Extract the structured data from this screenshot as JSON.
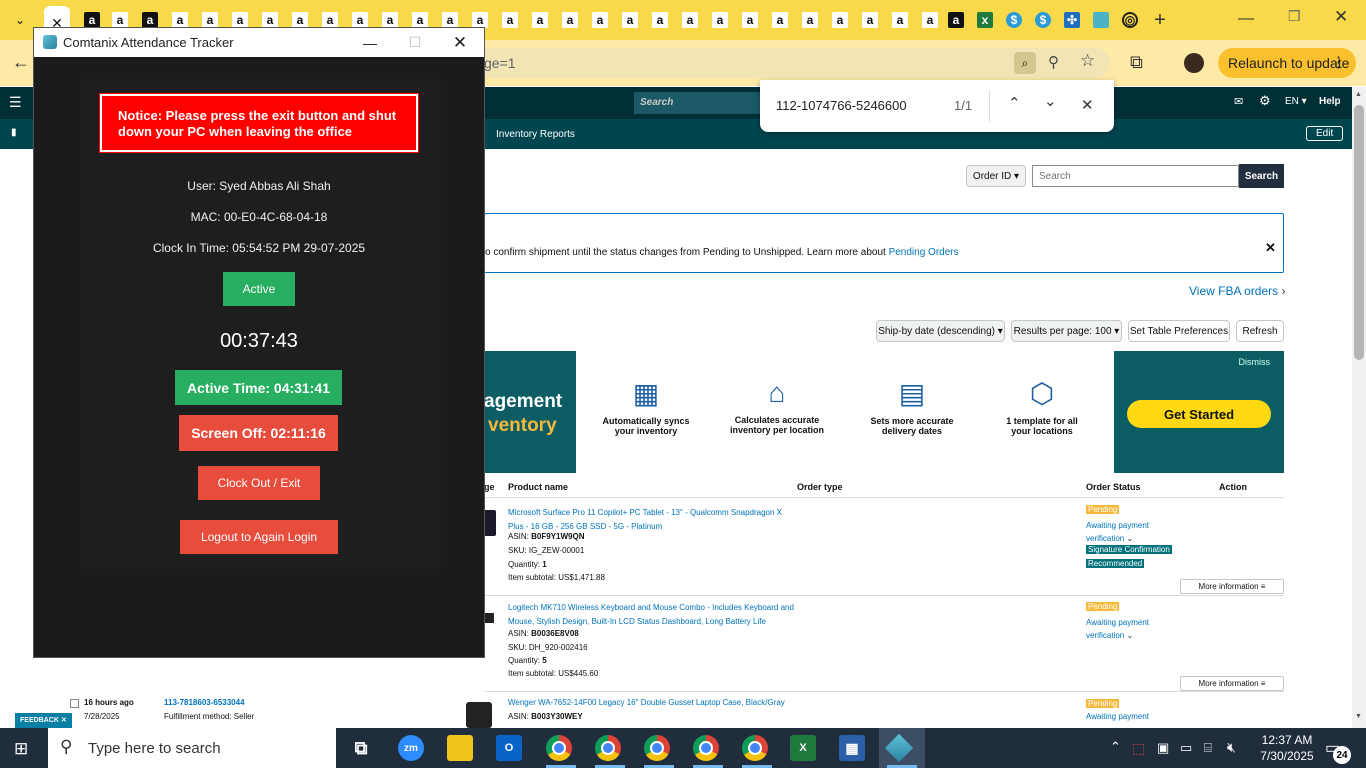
{
  "browser": {
    "relaunch_label": "Relaunch to update",
    "url_fragment": "ge=1"
  },
  "find_bar": {
    "query": "112-1074766-5246600",
    "count": "1/1"
  },
  "amazon": {
    "search_placeholder": "Search",
    "lang": "EN",
    "help": "Help",
    "inventory_reports": "Inventory Reports",
    "edit": "Edit",
    "order_id_select": "Order ID",
    "search_field_placeholder": "Search",
    "search_button": "Search",
    "banner_text": "o confirm shipment until the status changes from Pending to Unshipped. Learn more about ",
    "banner_link": "Pending Orders",
    "view_fba": "View FBA orders",
    "sort_select": "Ship-by date (descending)",
    "results_select": "Results per page: 100",
    "set_table_prefs": "Set Table Preferences",
    "refresh": "Refresh",
    "promo": {
      "title_line1": "agement",
      "title_line2": "ventory",
      "features": [
        {
          "icon": "barcode-scanner-icon",
          "label": "Automatically syncs your inventory"
        },
        {
          "icon": "warehouse-icon",
          "label": "Calculates accurate inventory per location"
        },
        {
          "icon": "calendar-check-icon",
          "label": "Sets more accurate delivery dates"
        },
        {
          "icon": "box-hand-icon",
          "label": "1 template for all your locations"
        }
      ],
      "dismiss": "Dismiss",
      "get_started": "Get Started"
    },
    "table_headers": {
      "age": "ge",
      "product": "Product name",
      "order_type": "Order type",
      "status": "Order Status",
      "action": "Action"
    },
    "orders": [
      {
        "product": "Microsoft Surface Pro 11 Copilot+ PC Tablet - 13\" - Qualcomm Snapdragon X Plus - 16 GB - 256 GB SSD - 5G - Platinum",
        "asin_label": "ASIN: ",
        "asin": "B0F9Y1W9QN",
        "sku": "SKU: IG_ZEW-00001",
        "qty_label": "Quantity: ",
        "qty": "1",
        "subtotal": "Item subtotal: US$1,471.88",
        "status_badge": "Pending",
        "status_text": "Awaiting payment verification",
        "sig1": "Signature Confirmation",
        "sig2": "Recommended",
        "more": "More information"
      },
      {
        "product": "Logitech MK710 Wireless Keyboard and Mouse Combo - Includes Keyboard and Mouse, Stylish Design, Built-In LCD Status Dashboard, Long Battery Life",
        "asin_label": "ASIN: ",
        "asin": "B0036E8V08",
        "sku": "SKU: DH_920-002416",
        "qty_label": "Quantity: ",
        "qty": "5",
        "subtotal": "Item subtotal: US$445.60",
        "status_badge": "Pending",
        "status_text": "Awaiting payment verification",
        "more": "More information"
      },
      {
        "age": "16 hours ago",
        "date": "7/28/2025",
        "order_id": "113-7818603-6533044",
        "fulfillment": "Fulfillment method: Seller",
        "product": "Wenger WA-7652-14F00 Legacy 16\" Double Gusset Laptop Case, Black/Gray",
        "asin_label": "ASIN: ",
        "asin": "B003Y30WEY",
        "status_badge": "Pending",
        "status_text": "Awaiting payment"
      }
    ],
    "feedback": "FEEDBACK"
  },
  "tracker": {
    "window_title": "Comtanix Attendance Tracker",
    "notice": "Notice: Please press the exit button and shut down your PC when leaving the office",
    "user": "User: Syed  Abbas Ali Shah",
    "mac": "MAC: 00-E0-4C-68-04-18",
    "clock_in": "Clock In Time: 05:54:52 PM 29-07-2025",
    "status": "Active",
    "timer": "00:37:43",
    "active_time": "Active Time: 04:31:41",
    "screen_off": "Screen Off: 02:11:16",
    "clock_out": "Clock Out / Exit",
    "logout": "Logout to Again Login"
  },
  "taskbar": {
    "search_placeholder": "Type here to search",
    "time": "12:37 AM",
    "date": "7/30/2025",
    "notifications": "24"
  },
  "colors": {
    "tab_strip": "#f8d94a",
    "amazon_nav": "#002f36",
    "tracker_green": "#27ae60",
    "tracker_red": "#e74c3c",
    "notice_red": "#ff0000"
  }
}
